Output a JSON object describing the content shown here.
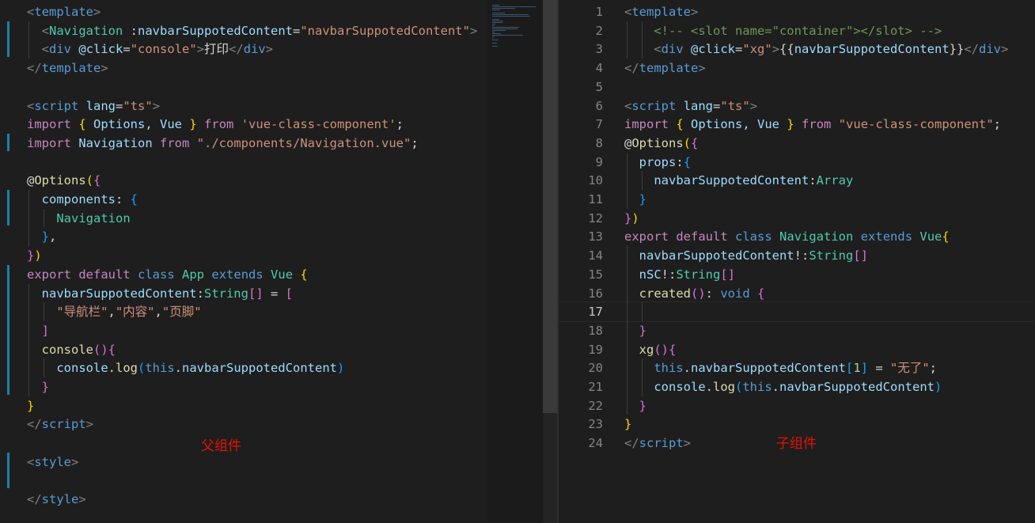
{
  "left_editor": {
    "lines": [
      [
        [
          "<",
          "tag"
        ],
        [
          "template",
          "name"
        ],
        [
          ">",
          "tag"
        ]
      ],
      [
        [
          "  ",
          "txt"
        ],
        [
          "<",
          "tag"
        ],
        [
          "Navigation",
          "type"
        ],
        [
          " :",
          "txt"
        ],
        [
          "navbarSuppotedContent",
          "attr"
        ],
        [
          "=",
          "txt"
        ],
        [
          "\"navbarSuppotedContent\"",
          "str"
        ],
        [
          ">",
          "tag"
        ]
      ],
      [
        [
          "  ",
          "txt"
        ],
        [
          "<",
          "tag"
        ],
        [
          "div",
          "name"
        ],
        [
          " ",
          "txt"
        ],
        [
          "@click",
          "attr"
        ],
        [
          "=",
          "txt"
        ],
        [
          "\"console\"",
          "str"
        ],
        [
          ">",
          "tag"
        ],
        [
          "打印",
          "txt"
        ],
        [
          "</",
          "tag"
        ],
        [
          "div",
          "name"
        ],
        [
          ">",
          "tag"
        ]
      ],
      [
        [
          "</",
          "tag"
        ],
        [
          "template",
          "name"
        ],
        [
          ">",
          "tag"
        ]
      ],
      [],
      [
        [
          "<",
          "tag"
        ],
        [
          "script",
          "name"
        ],
        [
          " ",
          "txt"
        ],
        [
          "lang",
          "attr"
        ],
        [
          "=",
          "txt"
        ],
        [
          "\"ts\"",
          "str"
        ],
        [
          ">",
          "tag"
        ]
      ],
      [
        [
          "import",
          "ctl"
        ],
        [
          " ",
          "txt"
        ],
        [
          "{",
          "b1"
        ],
        [
          " Options, Vue ",
          "var"
        ],
        [
          "}",
          "b1"
        ],
        [
          " ",
          "txt"
        ],
        [
          "from",
          "ctl"
        ],
        [
          " ",
          "txt"
        ],
        [
          "'vue-class-component'",
          "str"
        ],
        [
          ";",
          "txt"
        ]
      ],
      [
        [
          "import",
          "ctl"
        ],
        [
          " ",
          "txt"
        ],
        [
          "Navigation",
          "var"
        ],
        [
          " ",
          "txt"
        ],
        [
          "from",
          "ctl"
        ],
        [
          " ",
          "txt"
        ],
        [
          "\"./components/Navigation.vue\"",
          "str"
        ],
        [
          ";",
          "txt"
        ]
      ],
      [],
      [
        [
          "@",
          "txt"
        ],
        [
          "Options",
          "fn"
        ],
        [
          "(",
          "b1"
        ],
        [
          "{",
          "b2"
        ]
      ],
      [
        [
          "  ",
          "txt"
        ],
        [
          "components",
          "var"
        ],
        [
          ": ",
          "txt"
        ],
        [
          "{",
          "b3"
        ]
      ],
      [
        [
          "    ",
          "txt"
        ],
        [
          "Navigation",
          "type"
        ]
      ],
      [
        [
          "  ",
          "txt"
        ],
        [
          "}",
          "b3"
        ],
        [
          ",",
          "txt"
        ]
      ],
      [
        [
          "}",
          "b2"
        ],
        [
          ")",
          "b1"
        ]
      ],
      [
        [
          "export",
          "ctl"
        ],
        [
          " ",
          "txt"
        ],
        [
          "default",
          "ctl"
        ],
        [
          " ",
          "txt"
        ],
        [
          "class",
          "kw"
        ],
        [
          " ",
          "txt"
        ],
        [
          "App",
          "type"
        ],
        [
          " ",
          "txt"
        ],
        [
          "extends",
          "kw"
        ],
        [
          " ",
          "txt"
        ],
        [
          "Vue",
          "type"
        ],
        [
          " ",
          "txt"
        ],
        [
          "{",
          "b1"
        ]
      ],
      [
        [
          "  ",
          "txt"
        ],
        [
          "navbarSuppotedContent",
          "var"
        ],
        [
          ":",
          "txt"
        ],
        [
          "String",
          "type"
        ],
        [
          "[]",
          "b2"
        ],
        [
          " = ",
          "txt"
        ],
        [
          "[",
          "b2"
        ]
      ],
      [
        [
          "    ",
          "txt"
        ],
        [
          "\"导航栏\"",
          "str"
        ],
        [
          ",",
          "txt"
        ],
        [
          "\"内容\"",
          "str"
        ],
        [
          ",",
          "txt"
        ],
        [
          "\"页脚\"",
          "str"
        ]
      ],
      [
        [
          "  ",
          "txt"
        ],
        [
          "]",
          "b2"
        ]
      ],
      [
        [
          "  ",
          "txt"
        ],
        [
          "console",
          "fn"
        ],
        [
          "()",
          "b2"
        ],
        [
          "{",
          "b2"
        ]
      ],
      [
        [
          "    ",
          "txt"
        ],
        [
          "console",
          "var"
        ],
        [
          ".",
          "txt"
        ],
        [
          "log",
          "fn"
        ],
        [
          "(",
          "b3"
        ],
        [
          "this",
          "kw"
        ],
        [
          ".",
          "txt"
        ],
        [
          "navbarSuppotedContent",
          "var"
        ],
        [
          ")",
          "b3"
        ]
      ],
      [
        [
          "  ",
          "txt"
        ],
        [
          "}",
          "b2"
        ]
      ],
      [
        [
          "}",
          "b1"
        ]
      ],
      [
        [
          "</",
          "tag"
        ],
        [
          "script",
          "name"
        ],
        [
          ">",
          "tag"
        ]
      ],
      [],
      [
        [
          "<",
          "tag"
        ],
        [
          "style",
          "name"
        ],
        [
          ">",
          "tag"
        ]
      ],
      [],
      [
        [
          "</",
          "tag"
        ],
        [
          "style",
          "name"
        ],
        [
          ">",
          "tag"
        ]
      ]
    ],
    "annotation": "父组件"
  },
  "right_editor": {
    "line_numbers": [
      "1",
      "2",
      "3",
      "4",
      "5",
      "6",
      "7",
      "8",
      "9",
      "10",
      "11",
      "12",
      "13",
      "14",
      "15",
      "16",
      "17",
      "18",
      "19",
      "20",
      "21",
      "22",
      "23",
      "24"
    ],
    "active_line": 17,
    "lines": [
      [
        [
          "<",
          "tag"
        ],
        [
          "template",
          "name"
        ],
        [
          ">",
          "tag"
        ]
      ],
      [
        [
          "    ",
          "txt"
        ],
        [
          "<!-- <slot name=\"container\"></slot> -->",
          "cmt"
        ]
      ],
      [
        [
          "    ",
          "txt"
        ],
        [
          "<",
          "tag"
        ],
        [
          "div",
          "name"
        ],
        [
          " ",
          "txt"
        ],
        [
          "@click",
          "attr"
        ],
        [
          "=",
          "txt"
        ],
        [
          "\"xg\"",
          "str"
        ],
        [
          ">",
          "tag"
        ],
        [
          "{{",
          "txt"
        ],
        [
          "navbarSuppotedContent",
          "var"
        ],
        [
          "}}",
          "txt"
        ],
        [
          "</",
          "tag"
        ],
        [
          "div",
          "name"
        ],
        [
          ">",
          "tag"
        ]
      ],
      [
        [
          "</",
          "tag"
        ],
        [
          "template",
          "name"
        ],
        [
          ">",
          "tag"
        ]
      ],
      [],
      [
        [
          "<",
          "tag"
        ],
        [
          "script",
          "name"
        ],
        [
          " ",
          "txt"
        ],
        [
          "lang",
          "attr"
        ],
        [
          "=",
          "txt"
        ],
        [
          "\"ts\"",
          "str"
        ],
        [
          ">",
          "tag"
        ]
      ],
      [
        [
          "import",
          "ctl"
        ],
        [
          " ",
          "txt"
        ],
        [
          "{",
          "b1"
        ],
        [
          " Options, Vue ",
          "var"
        ],
        [
          "}",
          "b1"
        ],
        [
          " ",
          "txt"
        ],
        [
          "from",
          "ctl"
        ],
        [
          " ",
          "txt"
        ],
        [
          "\"vue-class-component\"",
          "str"
        ],
        [
          ";",
          "txt"
        ]
      ],
      [
        [
          "@",
          "txt"
        ],
        [
          "Options",
          "fn"
        ],
        [
          "(",
          "b1"
        ],
        [
          "{",
          "b2"
        ]
      ],
      [
        [
          "  ",
          "txt"
        ],
        [
          "props",
          "var"
        ],
        [
          ":",
          "txt"
        ],
        [
          "{",
          "b3"
        ]
      ],
      [
        [
          "    ",
          "txt"
        ],
        [
          "navbarSuppotedContent",
          "var"
        ],
        [
          ":",
          "txt"
        ],
        [
          "Array",
          "type"
        ]
      ],
      [
        [
          "  ",
          "txt"
        ],
        [
          "}",
          "b3"
        ]
      ],
      [
        [
          "}",
          "b2"
        ],
        [
          ")",
          "b1"
        ]
      ],
      [
        [
          "export",
          "ctl"
        ],
        [
          " ",
          "txt"
        ],
        [
          "default",
          "ctl"
        ],
        [
          " ",
          "txt"
        ],
        [
          "class",
          "kw"
        ],
        [
          " ",
          "txt"
        ],
        [
          "Navigation",
          "type"
        ],
        [
          " ",
          "txt"
        ],
        [
          "extends",
          "kw"
        ],
        [
          " ",
          "txt"
        ],
        [
          "Vue",
          "type"
        ],
        [
          "{",
          "b1"
        ]
      ],
      [
        [
          "  ",
          "txt"
        ],
        [
          "navbarSuppotedContent",
          "var"
        ],
        [
          "!:",
          "txt"
        ],
        [
          "String",
          "type"
        ],
        [
          "[]",
          "b2"
        ]
      ],
      [
        [
          "  ",
          "txt"
        ],
        [
          "nSC",
          "var"
        ],
        [
          "!:",
          "txt"
        ],
        [
          "String",
          "type"
        ],
        [
          "[]",
          "b2"
        ]
      ],
      [
        [
          "  ",
          "txt"
        ],
        [
          "created",
          "fn"
        ],
        [
          "()",
          "b2"
        ],
        [
          ": ",
          "txt"
        ],
        [
          "void",
          "kw"
        ],
        [
          " ",
          "txt"
        ],
        [
          "{",
          "b2"
        ]
      ],
      [],
      [
        [
          "  ",
          "txt"
        ],
        [
          "}",
          "b2"
        ]
      ],
      [
        [
          "  ",
          "txt"
        ],
        [
          "xg",
          "fn"
        ],
        [
          "()",
          "b2"
        ],
        [
          "{",
          "b2"
        ]
      ],
      [
        [
          "    ",
          "txt"
        ],
        [
          "this",
          "kw"
        ],
        [
          ".",
          "txt"
        ],
        [
          "navbarSuppotedContent",
          "var"
        ],
        [
          "[",
          "b3"
        ],
        [
          "1",
          "num"
        ],
        [
          "]",
          "b3"
        ],
        [
          " = ",
          "txt"
        ],
        [
          "\"无了\"",
          "str"
        ],
        [
          ";",
          "txt"
        ]
      ],
      [
        [
          "    ",
          "txt"
        ],
        [
          "console",
          "var"
        ],
        [
          ".",
          "txt"
        ],
        [
          "log",
          "fn"
        ],
        [
          "(",
          "b3"
        ],
        [
          "this",
          "kw"
        ],
        [
          ".",
          "txt"
        ],
        [
          "navbarSuppotedContent",
          "var"
        ],
        [
          ")",
          "b3"
        ]
      ],
      [
        [
          "  ",
          "txt"
        ],
        [
          "}",
          "b2"
        ]
      ],
      [
        [
          "}",
          "b1"
        ]
      ],
      [
        [
          "</",
          "tag"
        ],
        [
          "script",
          "name"
        ],
        [
          ">",
          "tag"
        ]
      ]
    ],
    "annotation": "子组件"
  }
}
